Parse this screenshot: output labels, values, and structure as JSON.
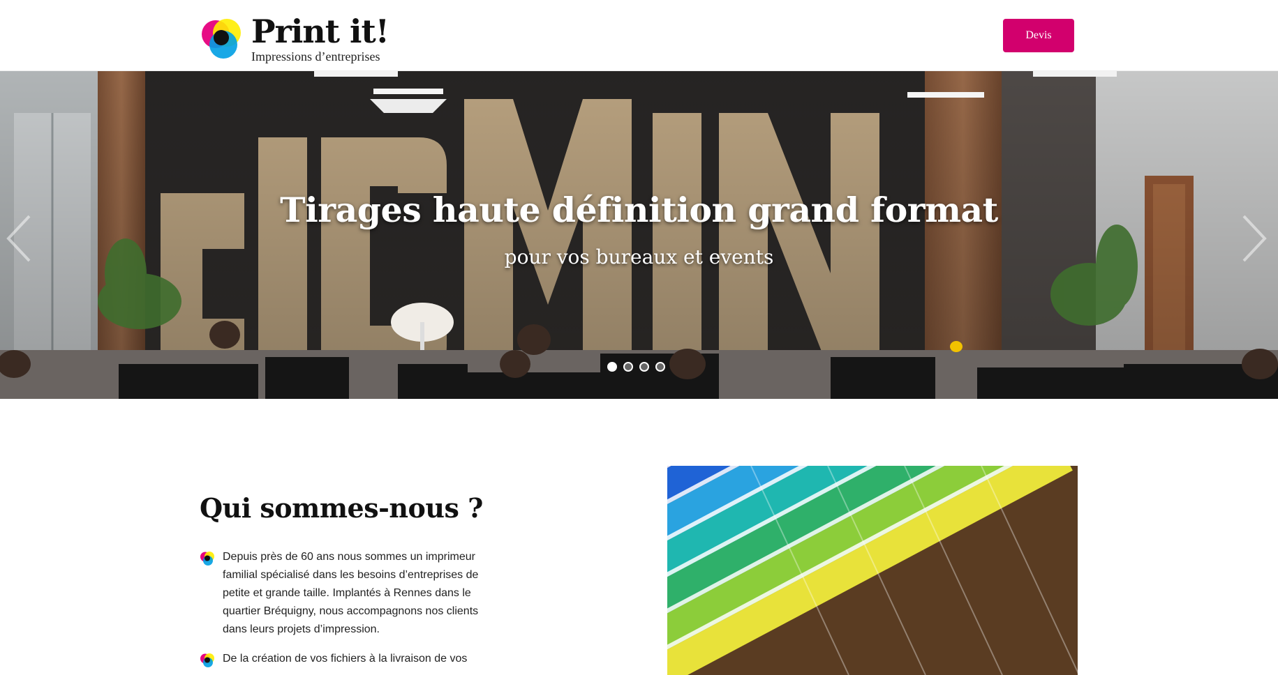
{
  "brand": {
    "name": "Print it!",
    "tagline": "Impressions d’entreprises",
    "logo_icon": "cmyk-circles-icon"
  },
  "header": {
    "devis_label": "Devis",
    "accent_color": "#d2006d"
  },
  "hero": {
    "title": "Tirages haute définition grand format",
    "subtitle": "pour vos bureaux et events",
    "slides_count": 4,
    "active_slide": 1,
    "prev_icon": "chevron-left-icon",
    "next_icon": "chevron-right-icon"
  },
  "about": {
    "title": "Qui sommes-nous ?",
    "items": [
      {
        "text": "Depuis près de 60 ans nous sommes un imprimeur familial spécialisé dans les besoins d’entreprises de petite et grande taille. Implantés à Rennes dans le quartier Bréquigny, nous accompagnons nos clients dans leurs projets d’impression."
      },
      {
        "text": "De la création de vos fichiers à la livraison de vos"
      }
    ]
  }
}
